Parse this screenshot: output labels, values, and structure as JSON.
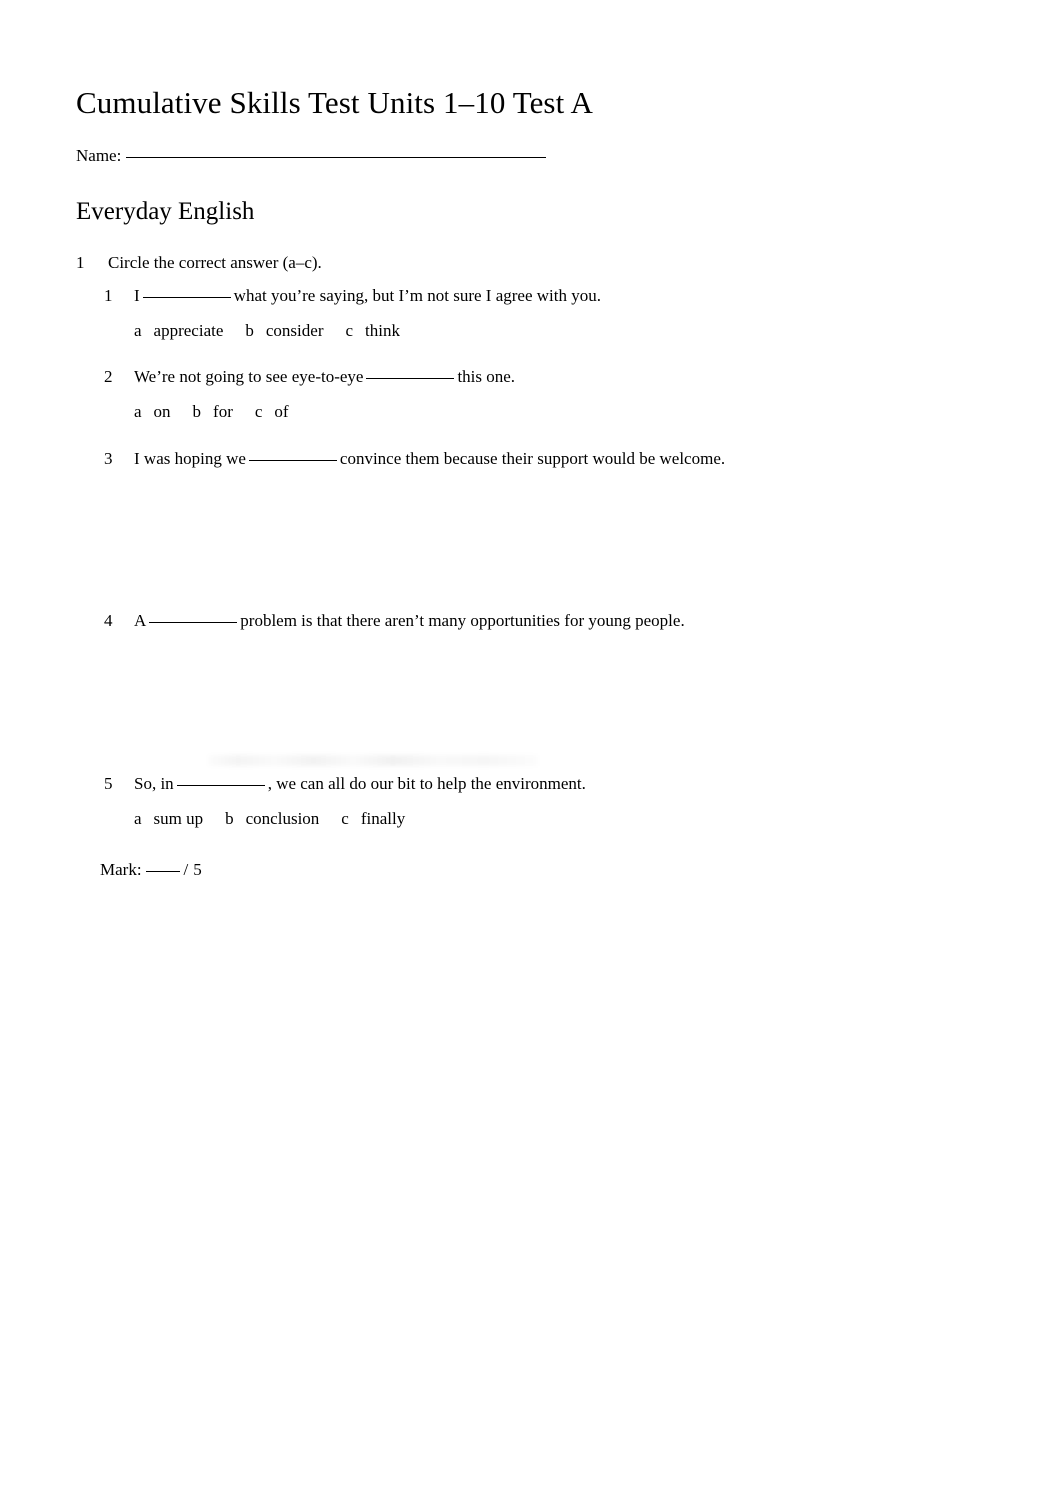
{
  "document": {
    "title": "Cumulative Skills Test Units 1–10 Test A",
    "name_field": {
      "label": "Name:",
      "value": "",
      "placeholder": ""
    },
    "section": {
      "heading": "Everyday English"
    },
    "exercise": {
      "number": "1",
      "instruction": "Circle the correct answer (a–c).",
      "questions": [
        {
          "number": "1",
          "text_before": "I",
          "text_after": "what you’re saying, but I’m not sure I agree with you.",
          "full_text": "I ________ what you’re saying, but I’m not sure I agree with you.",
          "options": [
            {
              "letter": "a",
              "text": "appreciate"
            },
            {
              "letter": "b",
              "text": "consider"
            },
            {
              "letter": "c",
              "text": "think"
            }
          ],
          "options_visible": true
        },
        {
          "number": "2",
          "text_before": "We’re not going to see eye-to-eye",
          "text_after": "this one.",
          "full_text": "We’re not going to see eye-to-eye ________ this one.",
          "options": [
            {
              "letter": "a",
              "text": "on"
            },
            {
              "letter": "b",
              "text": "for"
            },
            {
              "letter": "c",
              "text": "of"
            }
          ],
          "options_visible": true
        },
        {
          "number": "3",
          "text_before": "I was hoping we",
          "text_after": "convince them because their support would be welcome.",
          "full_text": "I was hoping we ________ convince them because their support would be welcome.",
          "options": [],
          "options_visible": false
        },
        {
          "number": "4",
          "text_before": "A",
          "text_after": "problem is that there aren’t many opportunities for young people.",
          "full_text": "A ________ problem is that there aren’t many opportunities for young people.",
          "options": [],
          "options_visible": false
        },
        {
          "number": "5",
          "text_before": "So, in",
          "text_after": ", we can all do our bit to help the environment.",
          "full_text": "So, in ________ , we can all do our bit to help the environment.",
          "options": [
            {
              "letter": "a",
              "text": "sum up"
            },
            {
              "letter": "b",
              "text": "conclusion"
            },
            {
              "letter": "c",
              "text": "finally"
            }
          ],
          "options_visible": true
        }
      ],
      "mark": {
        "label": "Mark:",
        "value": "",
        "separator": "/",
        "total": "5"
      }
    }
  },
  "colors": {
    "page_background": "#ffffff",
    "text": "#000000",
    "rule": "#000000"
  }
}
